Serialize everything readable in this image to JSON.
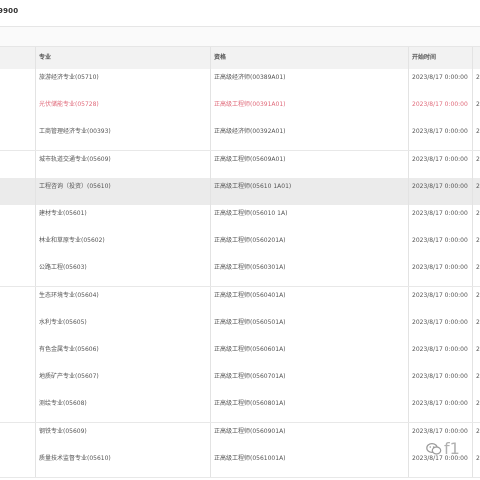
{
  "top_reference": "9900",
  "table": {
    "columns": {
      "major": "专业",
      "qualification": "资格",
      "start_time": "开始时间",
      "end_time_partial": ""
    },
    "rows": [
      {
        "major": "旅游经济专业(05710)",
        "qualification": "正高级经济师(00389A01)",
        "start": "2023/8/17 0:00:00",
        "end": "2",
        "style": "normal"
      },
      {
        "major": "光伏储能专业(05728)",
        "qualification": "正高级工程师(00391A01)",
        "start": "2023/8/17 0:00:00",
        "end": "2",
        "style": "red"
      },
      {
        "major": "工商管理经济专业(00393)",
        "qualification": "正高级经济师(00392A01)",
        "start": "2023/8/17 0:00:00",
        "end": "2",
        "style": "normal"
      },
      {
        "major": "城市轨道交通专业(05609)",
        "qualification": "正高级工程师(05609A01)",
        "start": "2023/8/17 0:00:00",
        "end": "2",
        "style": "normal"
      },
      {
        "major": "工程咨询（投资）(05610)",
        "qualification": "正高级工程师(05610 1A01)",
        "start": "2023/8/17 0:00:00",
        "end": "2",
        "style": "selected"
      },
      {
        "major": "建材专业(05601)",
        "qualification": "正高级工程师(056010 1A)",
        "start": "2023/8/17 0:00:00",
        "end": "2",
        "style": "normal"
      },
      {
        "major": "林业和草原专业(05602)",
        "qualification": "正高级工程师(0560201A)",
        "start": "2023/8/17 0:00:00",
        "end": "2",
        "style": "normal"
      },
      {
        "major": "公路工程(05603)",
        "qualification": "正高级工程师(0560301A)",
        "start": "2023/8/17 0:00:00",
        "end": "2",
        "style": "normal"
      },
      {
        "major": "生态环境专业(05604)",
        "qualification": "正高级工程师(0560401A)",
        "start": "2023/8/17 0:00:00",
        "end": "2",
        "style": "normal"
      },
      {
        "major": "水利专业(05605)",
        "qualification": "正高级工程师(0560501A)",
        "start": "2023/8/17 0:00:00",
        "end": "2",
        "style": "normal"
      },
      {
        "major": "有色金属专业(05606)",
        "qualification": "正高级工程师(0560601A)",
        "start": "2023/8/17 0:00:00",
        "end": "2",
        "style": "normal"
      },
      {
        "major": "地质矿产专业(05607)",
        "qualification": "正高级工程师(0560701A)",
        "start": "2023/8/17 0:00:00",
        "end": "2",
        "style": "normal"
      },
      {
        "major": "测绘专业(05608)",
        "qualification": "正高级工程师(0560801A)",
        "start": "2023/8/17 0:00:00",
        "end": "2",
        "style": "normal"
      },
      {
        "major": "钢铁专业(05609)",
        "qualification": "正高级工程师(0560901A)",
        "start": "2023/8/17 0:00:00",
        "end": "2",
        "style": "normal"
      },
      {
        "major": "质量技术监督专业(05610)",
        "qualification": "正高级工程师(0561001A)",
        "start": "2023/8/17 0:00:00",
        "end": "2",
        "style": "normal"
      }
    ]
  },
  "watermark": {
    "icon": "wechat-icon",
    "text": "f1"
  },
  "colors": {
    "header_bg": "#f2f2f2",
    "selected_row": "#ebebeb",
    "highlight_text": "#e06a7a"
  }
}
